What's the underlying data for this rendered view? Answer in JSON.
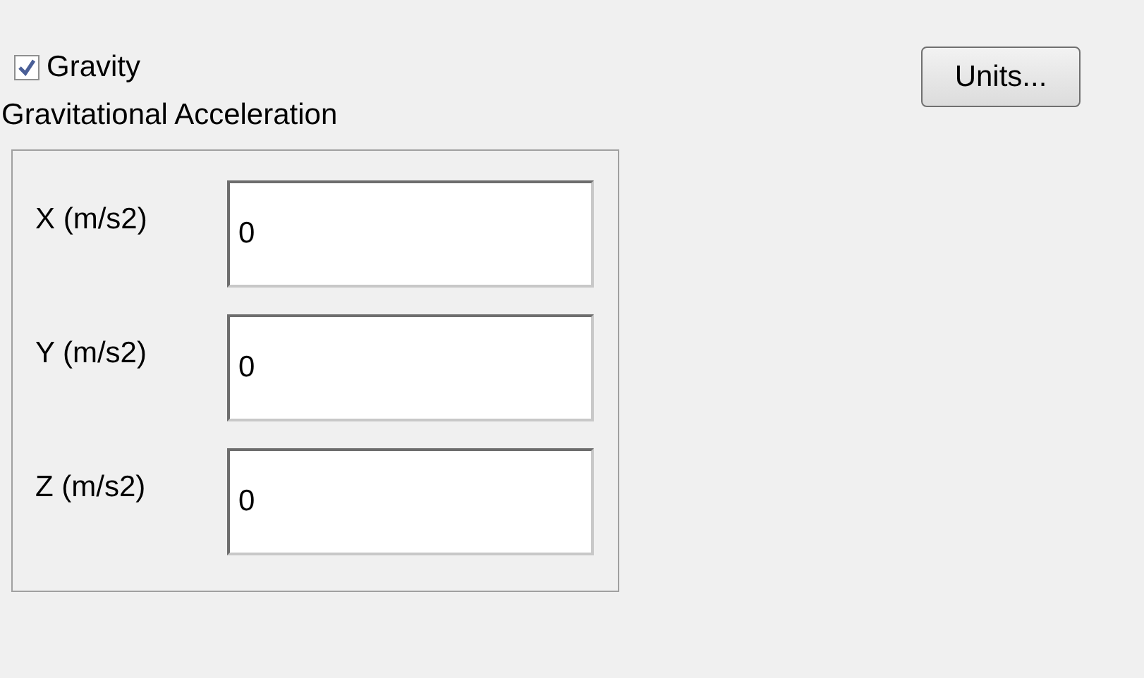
{
  "gravity": {
    "label": "Gravity",
    "checked": true
  },
  "units_button": {
    "label": "Units..."
  },
  "group": {
    "title": "Gravitational Acceleration",
    "fields": [
      {
        "label": "X (m/s2)",
        "value": "0"
      },
      {
        "label": "Y (m/s2)",
        "value": "0"
      },
      {
        "label": "Z (m/s2)",
        "value": "0"
      }
    ]
  }
}
